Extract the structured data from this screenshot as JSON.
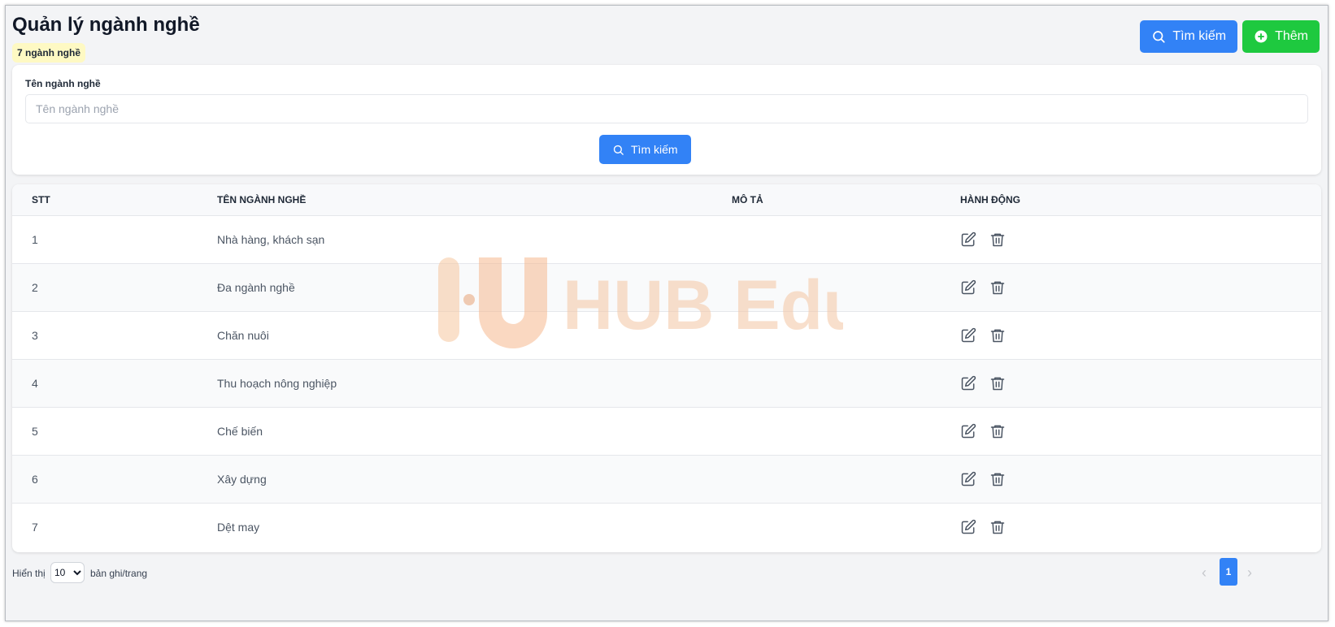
{
  "header": {
    "title": "Quản lý ngành nghề",
    "count_badge": "7 ngành nghề",
    "search_button": "Tìm kiếm",
    "add_button": "Thêm"
  },
  "filter": {
    "label": "Tên ngành nghề",
    "placeholder": "Tên ngành nghề",
    "value": "",
    "search_button": "Tìm kiếm"
  },
  "table": {
    "headers": [
      "STT",
      "TÊN NGÀNH NGHỀ",
      "MÔ TẢ",
      "HÀNH ĐỘNG"
    ],
    "rows": [
      {
        "stt": "1",
        "name": "Nhà hàng, khách sạn",
        "description": ""
      },
      {
        "stt": "2",
        "name": "Đa ngành nghề",
        "description": ""
      },
      {
        "stt": "3",
        "name": "Chăn nuôi",
        "description": ""
      },
      {
        "stt": "4",
        "name": "Thu hoạch nông nghiệp",
        "description": ""
      },
      {
        "stt": "5",
        "name": "Chế biến",
        "description": ""
      },
      {
        "stt": "6",
        "name": "Xây dựng",
        "description": ""
      },
      {
        "stt": "7",
        "name": "Dệt may",
        "description": ""
      }
    ],
    "row_icons": [
      "edit-icon",
      "trash-icon"
    ]
  },
  "watermark": {
    "text": "HUB Edu"
  },
  "footer": {
    "show_label": "Hiển thị",
    "page_size": "10",
    "per_page_label": "bản ghi/trang",
    "current_page": "1"
  },
  "colors": {
    "primary": "#3282f6",
    "success": "#1ec93f",
    "badge_bg": "#fef9c3",
    "watermark": "#f8c99a"
  }
}
